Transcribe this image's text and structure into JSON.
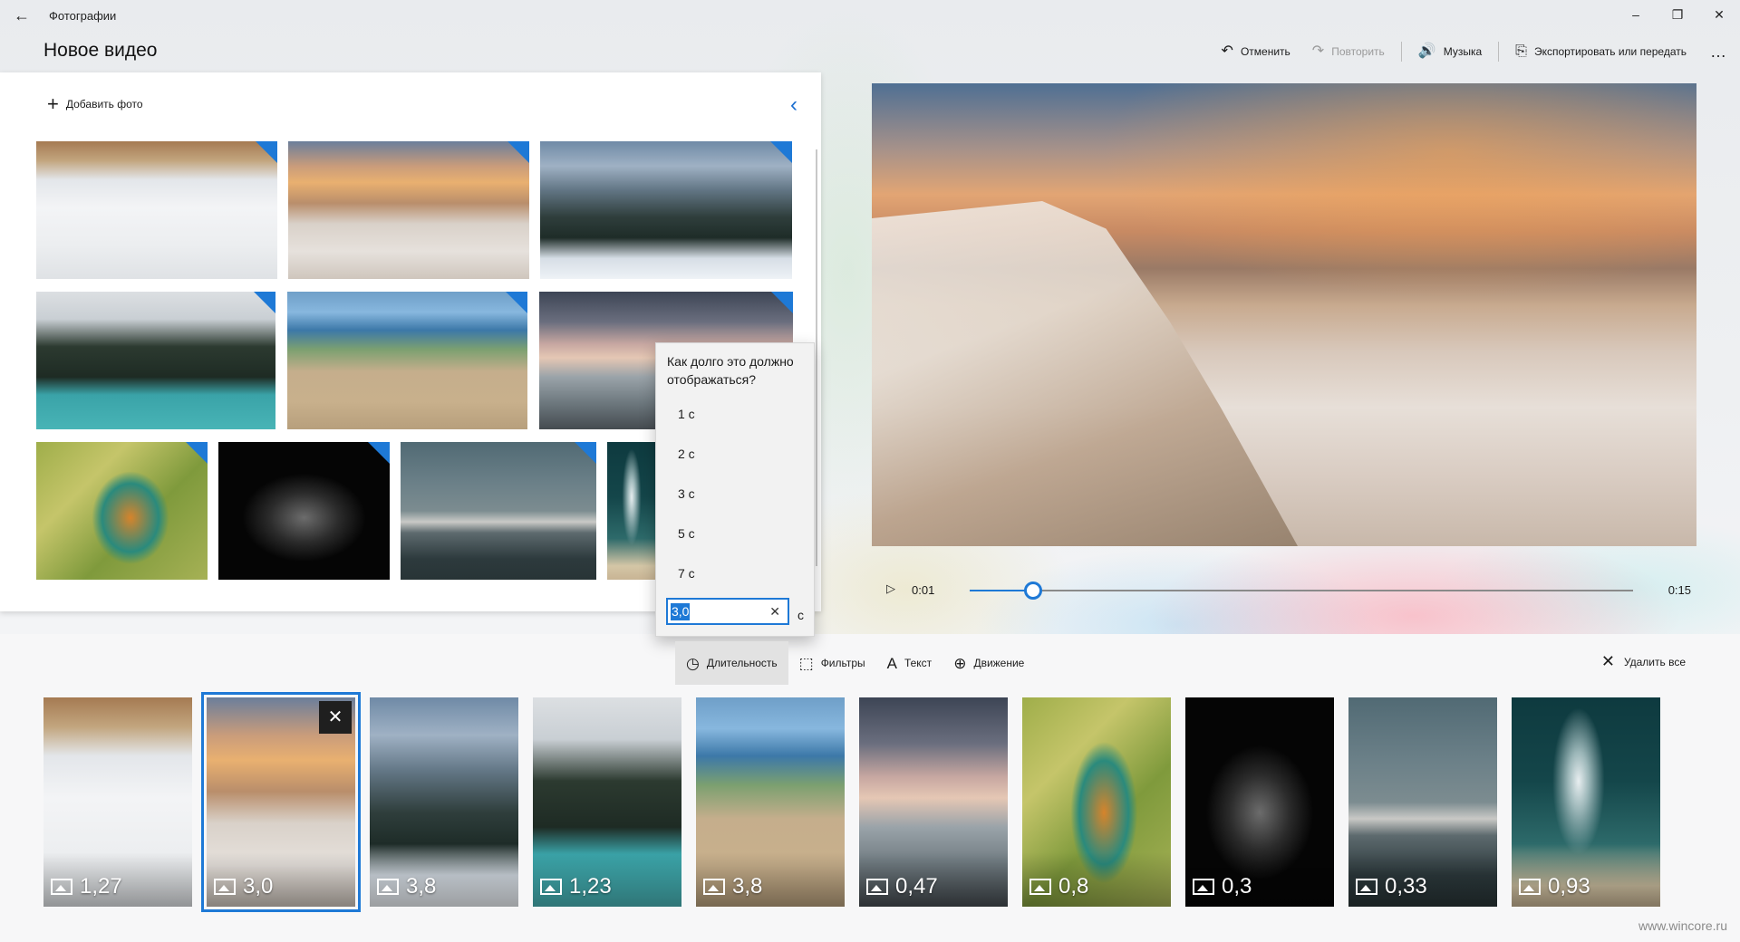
{
  "app": {
    "title": "Фотографии",
    "back_icon": "←"
  },
  "window": {
    "minimize": "–",
    "maximize": "❐",
    "close": "✕"
  },
  "page_title": "Новое видео",
  "commands": {
    "undo": {
      "icon": "↶",
      "label": "Отменить"
    },
    "redo": {
      "icon": "↷",
      "label": "Повторить"
    },
    "music": {
      "icon": "🔊",
      "label": "Музыка"
    },
    "export": {
      "icon": "⎘",
      "label": "Экспортировать или передать"
    },
    "more": "…"
  },
  "library": {
    "add_photo": {
      "icon": "+",
      "label": "Добавить фото"
    },
    "collapse_icon": "‹"
  },
  "player": {
    "current_time": "0:01",
    "total_time": "0:15",
    "progress": 0.095,
    "play_icon": "▷"
  },
  "duration_flyout": {
    "question": "Как долго это должно отображаться?",
    "options": [
      "1 с",
      "2 с",
      "3 с",
      "5 с",
      "7 с"
    ],
    "input_value": "3,0",
    "clear_icon": "✕",
    "unit": "с"
  },
  "storyboard_toolbar": {
    "duration": {
      "icon": "◷",
      "label": "Длительность"
    },
    "filters": {
      "icon": "⬚",
      "label": "Фильтры"
    },
    "text": {
      "icon": "A",
      "label": "Текст"
    },
    "motion": {
      "icon": "⊕",
      "label": "Движение"
    },
    "delete_all": {
      "icon": "✕",
      "label": "Удалить все"
    }
  },
  "storyboard": [
    {
      "duration": "1,27",
      "photo": "hares"
    },
    {
      "duration": "3,0",
      "photo": "cliff",
      "selected": true,
      "close_icon": "✕"
    },
    {
      "duration": "3,8",
      "photo": "valley"
    },
    {
      "duration": "1,23",
      "photo": "lake"
    },
    {
      "duration": "3,8",
      "photo": "dune"
    },
    {
      "duration": "0,47",
      "photo": "pier"
    },
    {
      "duration": "0,8",
      "photo": "parrot"
    },
    {
      "duration": "0,3",
      "photo": "tower"
    },
    {
      "duration": "0,33",
      "photo": "mountain"
    },
    {
      "duration": "0,93",
      "photo": "wave"
    }
  ],
  "watermark": "www.wincore.ru"
}
